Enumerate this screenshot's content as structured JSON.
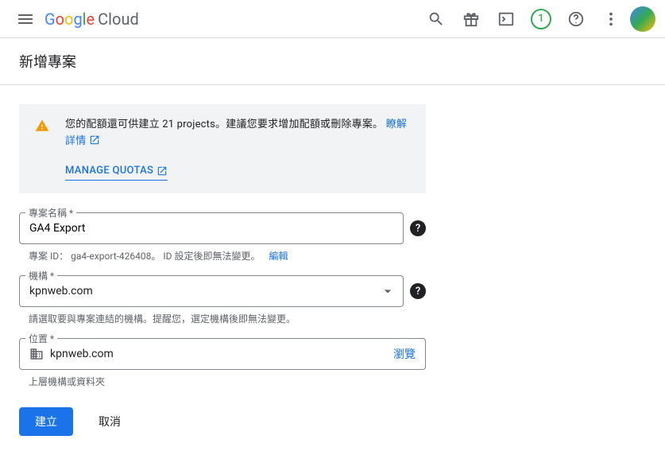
{
  "header": {
    "logo_cloud": "Cloud",
    "badge_count": "1"
  },
  "page": {
    "title": "新增專案"
  },
  "notice": {
    "text_pre": "您的配額還可供建立 ",
    "text_bold": "21 projects",
    "text_post": "。建議您要求增加配額或刪除專案。",
    "learn_more": "瞭解詳情",
    "manage_quotas": "MANAGE QUOTAS"
  },
  "form": {
    "name": {
      "label": "專案名稱 *",
      "value": "GA4 Export",
      "helper_pre": "專案 ID：",
      "project_id": "ga4-export-426408",
      "helper_post": "。 ID 設定後即無法變更。",
      "edit": "編輯"
    },
    "org": {
      "label": "機構 *",
      "value": "kpnweb.com",
      "helper": "請選取要與專案連結的機構。提醒您，選定機構後即無法變更。"
    },
    "location": {
      "label": "位置 *",
      "value": "kpnweb.com",
      "browse": "瀏覽",
      "helper": "上層機構或資料夾"
    }
  },
  "actions": {
    "create": "建立",
    "cancel": "取消"
  }
}
